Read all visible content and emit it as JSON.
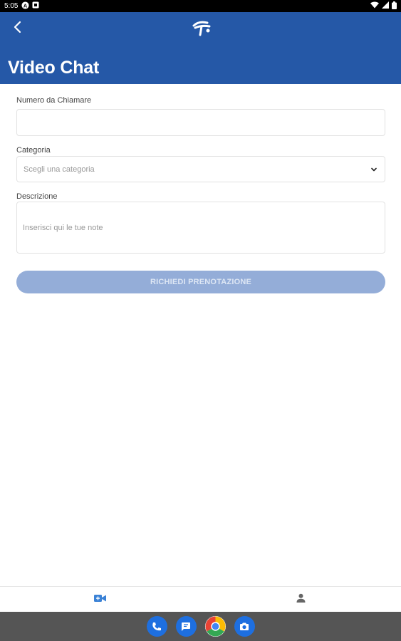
{
  "status_bar": {
    "time": "5:05",
    "icons": [
      "a-badge-icon",
      "notification-square-icon",
      "wifi-icon",
      "signal-icon",
      "battery-icon"
    ]
  },
  "app_bar": {
    "title": "Video Chat",
    "background_color": "#2558a7",
    "icons": [
      "back-arrow-icon",
      "app-logo-icon"
    ]
  },
  "form": {
    "phone": {
      "label": "Numero da Chiamare",
      "value": "",
      "placeholder": ""
    },
    "category": {
      "label": "Categoria",
      "placeholder": "Scegli una categoria"
    },
    "description": {
      "label": "Descrizione",
      "placeholder": "Inserisci qui le tue note"
    },
    "submit_label": "RICHIEDI PRENOTAZIONE",
    "submit_color": "#94add8"
  },
  "bottom_nav": {
    "items": [
      {
        "icon": "video-call-icon",
        "active": true,
        "color": "#3b82d6"
      },
      {
        "icon": "person-icon",
        "active": false,
        "color": "#777777"
      }
    ]
  },
  "dock": {
    "apps": [
      "phone-icon",
      "messages-icon",
      "chrome-icon",
      "camera-icon"
    ]
  }
}
